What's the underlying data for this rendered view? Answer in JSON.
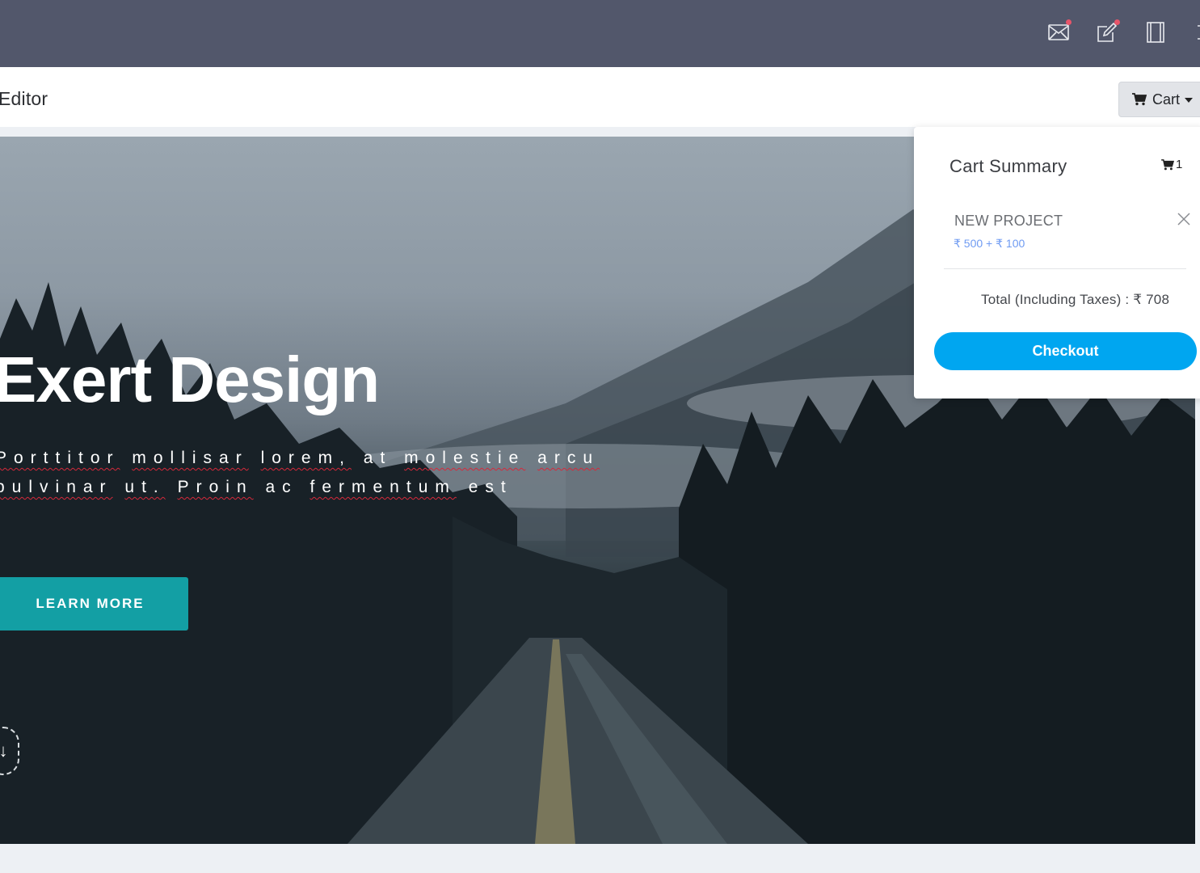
{
  "topbar": {
    "icons": [
      "mail-icon",
      "edit-icon",
      "layout-icon",
      "puzzle-icon"
    ],
    "notification_color": "#e8556a",
    "background": "#52576b"
  },
  "subbar": {
    "title": "Editor",
    "cart_button_label": "Cart"
  },
  "hero": {
    "title": "Exert Design",
    "text_words": [
      "Porttitor",
      "mollisar",
      "lorem,",
      "at",
      "molestie",
      "arcu",
      "pulvinar",
      "ut.",
      "Proin",
      "ac",
      "fermentum",
      "est"
    ],
    "button_label": "LEARN MORE",
    "button_color": "#139fa4",
    "scroll_arrow": "↓"
  },
  "cart_summary": {
    "title": "Cart Summary",
    "count": "1",
    "items": [
      {
        "name": "NEW PROJECT",
        "price": "₹ 500 + ₹ 100"
      }
    ],
    "total_label": "Total (Including Taxes) :",
    "total_value": "₹ 708",
    "checkout_label": "Checkout",
    "checkout_color": "#00a6f0"
  }
}
